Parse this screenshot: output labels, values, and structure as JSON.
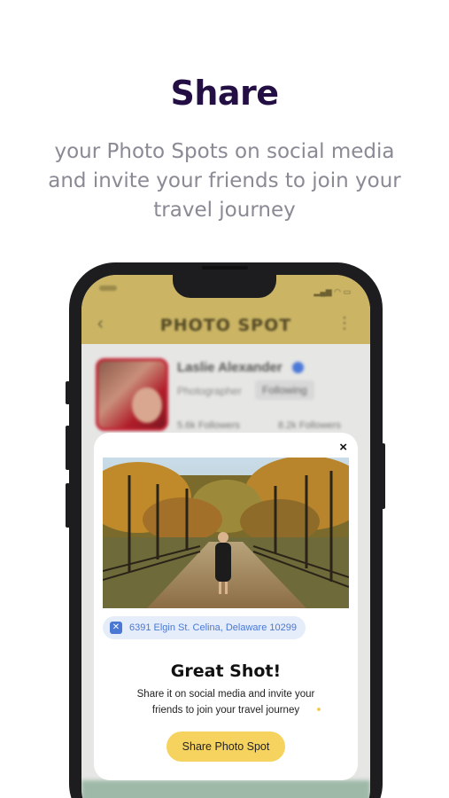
{
  "headline": "Share",
  "subtitle": "your Photo Spots on social media and invite your friends to join your travel journey",
  "app": {
    "title": "PHOTO SPOT",
    "profile": {
      "name": "Laslie Alexander",
      "role": "Photographer",
      "follow_label": "Following",
      "followers": "5.6k Followers",
      "following": "8.2k Followers"
    }
  },
  "modal": {
    "close_label": "×",
    "location": "6391 Elgin St. Celina, Delaware 10299",
    "title": "Great Shot!",
    "body": "Share it on social media and invite your friends to join your travel journey",
    "share_button": "Share Photo Spot"
  },
  "colors": {
    "headline": "#230f44",
    "app_bar": "#cbb565",
    "button": "#f6d35f",
    "location_accent": "#4a78d4"
  }
}
